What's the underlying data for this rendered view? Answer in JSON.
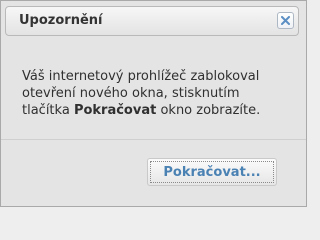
{
  "dialog": {
    "title": "Upozornění",
    "close_icon": "close-icon",
    "message": {
      "line1": "Váš internetový prohlížeč zablokoval",
      "line2": "otevření nového okna, stisknutím",
      "line3_prefix": "tlačítka ",
      "line3_bold": "Pokračovat",
      "line3_suffix": " okno zobrazíte."
    },
    "continue_label": "Pokračovat..."
  },
  "colors": {
    "accent_text": "#4b82b4",
    "close_icon": "#5b8fc4",
    "background": "#e4e4e4"
  }
}
